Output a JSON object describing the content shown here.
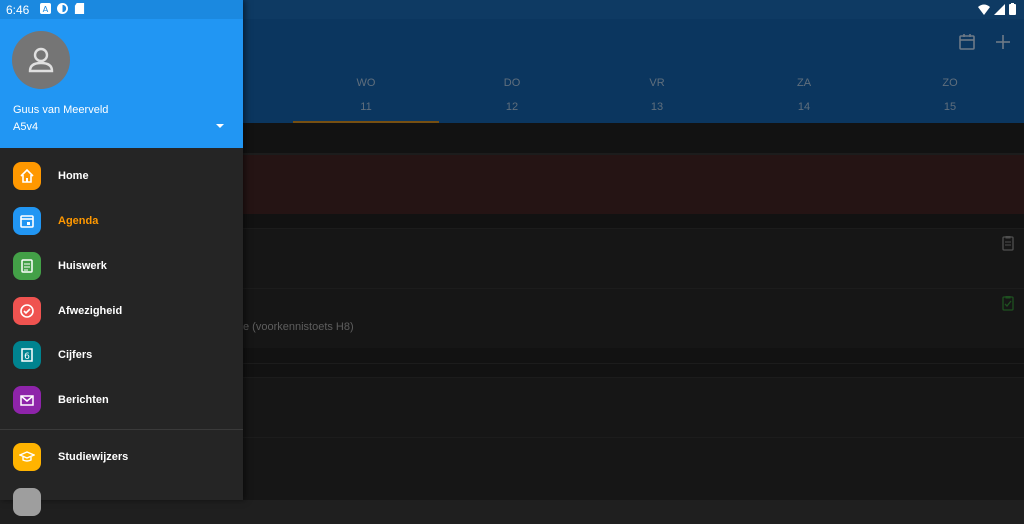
{
  "status": {
    "time": "6:46"
  },
  "appbar": {
    "days": [
      {
        "name": "WO",
        "date": "11"
      },
      {
        "name": "DO",
        "date": "12"
      },
      {
        "name": "VR",
        "date": "13"
      },
      {
        "name": "ZA",
        "date": "14"
      },
      {
        "name": "ZO",
        "date": "15"
      }
    ]
  },
  "content": {
    "item_text": "e (voorkennistoets H8)"
  },
  "drawer": {
    "user_name": "Guus van Meerveld",
    "user_class": "A5v4",
    "items": [
      {
        "label": "Home",
        "color": "#ff9800"
      },
      {
        "label": "Agenda",
        "color": "#2196f3"
      },
      {
        "label": "Huiswerk",
        "color": "#43a047"
      },
      {
        "label": "Afwezigheid",
        "color": "#ef5350"
      },
      {
        "label": "Cijfers",
        "color": "#00838f"
      },
      {
        "label": "Berichten",
        "color": "#8e24aa"
      },
      {
        "label": "Studiewijzers",
        "color": "#ffb300"
      }
    ],
    "active_color": "#ff9800"
  }
}
